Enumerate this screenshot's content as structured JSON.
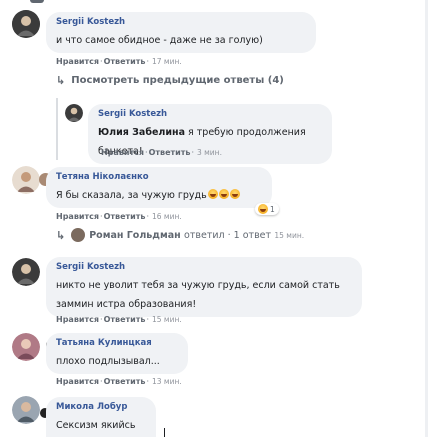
{
  "actions": {
    "like": "Нравится",
    "reply": "Ответить",
    "sep": "·"
  },
  "comments": [
    {
      "author": "Sergii Kostezh",
      "text": "и что самое обидное - даже не за голую)",
      "time": "17 мин."
    },
    {
      "view_replies": "Посмотреть предыдущие ответы (4)"
    },
    {
      "author": "Sergii Kostezh",
      "mention": "Юлия Забелина",
      "text": " я требую продолжения банкета!",
      "time": "3 мин."
    },
    {
      "author": "Тетяна Ніколаєнко",
      "text": "Я бы сказала, за чужую грудь",
      "time": "16 мин.",
      "reaction_count": "1"
    },
    {
      "reply_summary_name": "Роман Гольдман",
      "reply_summary_text": "ответил · 1 ответ",
      "reply_summary_time": "15 мин."
    },
    {
      "author": "Sergii Kostezh",
      "text": "никто не уволит тебя за чужую грудь, если самой стать заммин истра образования!",
      "time": "15 мин."
    },
    {
      "author": "Татьяна Кулинцкая",
      "text": "плохо подлызывал...",
      "time": "13 мин."
    },
    {
      "author": "Микола Лобур",
      "text": "Сексизм якийсь"
    }
  ],
  "colors": {
    "bubble": "#f0f2f5",
    "author": "#385898",
    "meta": "#606770"
  }
}
